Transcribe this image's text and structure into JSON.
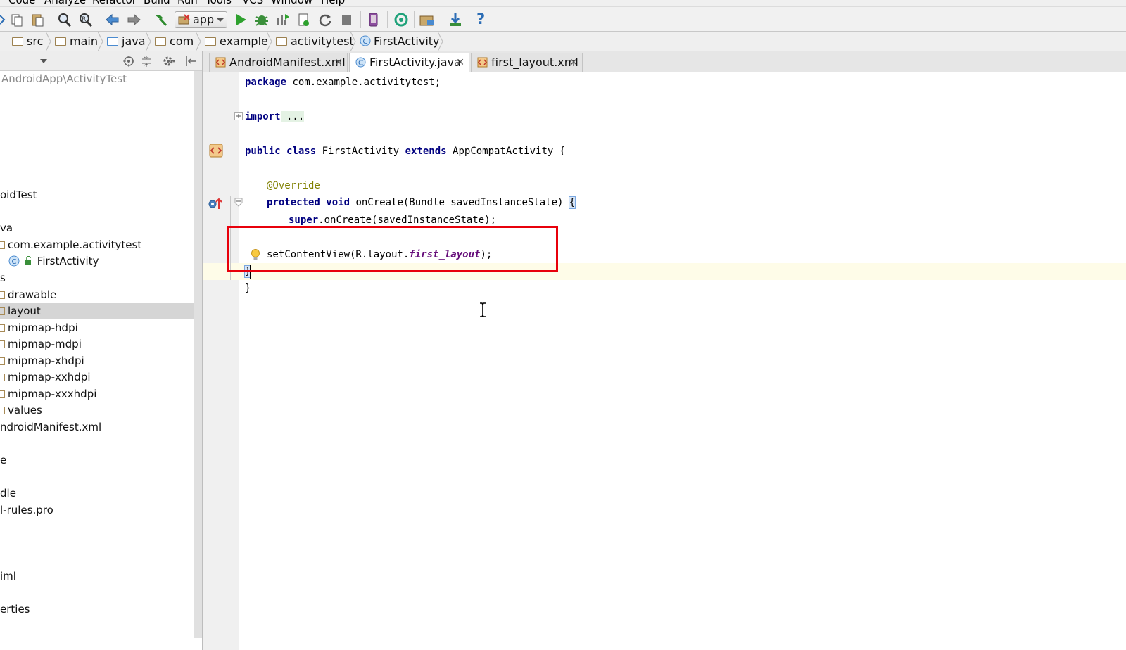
{
  "menubar": [
    "Code",
    "Analyze",
    "Refactor",
    "Build",
    "Run",
    "Tools",
    "VCS",
    "Window",
    "Help"
  ],
  "toolbar": {
    "run_config": "app",
    "help": "?"
  },
  "breadcrumb": [
    "src",
    "main",
    "java",
    "com",
    "example",
    "activitytest",
    "FirstActivity"
  ],
  "project_tree": {
    "path": "AndroidApp\\ActivityTest",
    "items": [
      "oidTest",
      "va",
      "com.example.activitytest",
      "FirstActivity",
      "s",
      "drawable",
      "layout",
      "mipmap-hdpi",
      "mipmap-mdpi",
      "mipmap-xhdpi",
      "mipmap-xxhdpi",
      "mipmap-xxxhdpi",
      "values",
      "ndroidManifest.xml",
      "e",
      "dle",
      "l-rules.pro",
      "iml",
      "erties"
    ],
    "selected": "layout"
  },
  "tabs": [
    {
      "label": "AndroidManifest.xml",
      "active": false
    },
    {
      "label": "FirstActivity.java",
      "active": true
    },
    {
      "label": "first_layout.xml",
      "active": false
    }
  ],
  "tab_close": "✕",
  "code": {
    "kw_package": "package",
    "package_name": " com.example.activitytest;",
    "kw_import": "import",
    "import_folded": " ...",
    "kw_public_class": "public class",
    "class_name": " FirstActivity ",
    "kw_extends": "extends",
    "superclass": " AppCompatActivity {",
    "annotation": "@Override",
    "kw_protected_void": "protected void",
    "method_sig": " onCreate(Bundle savedInstanceState) ",
    "open_brace": "{",
    "kw_super": "super",
    "super_call": ".onCreate(savedInstanceState);",
    "set_content_pre": "setContentView(R.layout.",
    "set_content_field": "first_layout",
    "set_content_post": ");",
    "close_brace": "}"
  },
  "colors": {
    "keyword": "#000080",
    "annotation": "#808000",
    "field": "#660e7a",
    "highlight_box": "#e8000b"
  }
}
